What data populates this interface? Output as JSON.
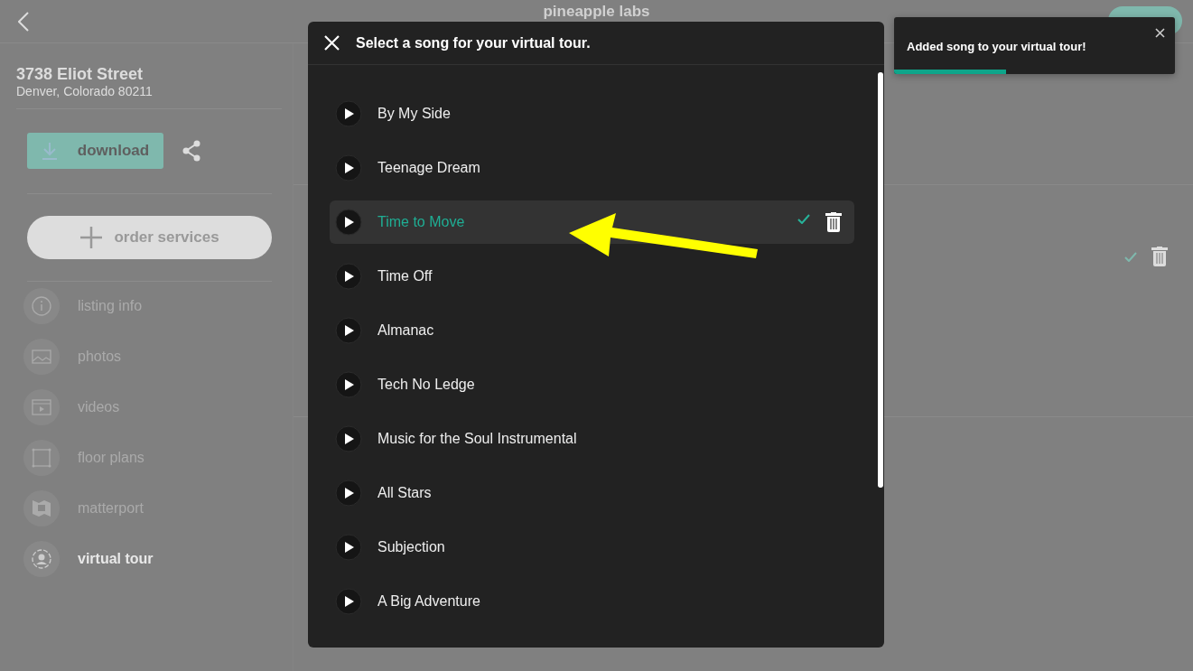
{
  "header": {
    "title": "pineapple labs"
  },
  "sidebar": {
    "address": "3738 Eliot Street",
    "city": "Denver, Colorado 80211",
    "download": "download",
    "order": "order services",
    "items": [
      {
        "label": "listing info",
        "kind": "info",
        "selected": false
      },
      {
        "label": "photos",
        "kind": "image",
        "selected": false
      },
      {
        "label": "videos",
        "kind": "video",
        "selected": false
      },
      {
        "label": "floor plans",
        "kind": "plan",
        "selected": false
      },
      {
        "label": "matterport",
        "kind": "map",
        "selected": false
      },
      {
        "label": "virtual tour",
        "kind": "person",
        "selected": true
      }
    ]
  },
  "modal": {
    "title": "Select a song for your virtual tour.",
    "songs": [
      {
        "title": "By My Side",
        "selected": false
      },
      {
        "title": "Teenage Dream",
        "selected": false
      },
      {
        "title": "Time to Move",
        "selected": true
      },
      {
        "title": "Time Off",
        "selected": false
      },
      {
        "title": "Almanac",
        "selected": false
      },
      {
        "title": "Tech No Ledge",
        "selected": false
      },
      {
        "title": "Music for the Soul Instrumental",
        "selected": false
      },
      {
        "title": "All Stars",
        "selected": false
      },
      {
        "title": "Subjection",
        "selected": false
      },
      {
        "title": "A Big Adventure",
        "selected": false
      }
    ]
  },
  "toast": {
    "message": "Added song to your virtual tour!",
    "level": 0.4
  }
}
